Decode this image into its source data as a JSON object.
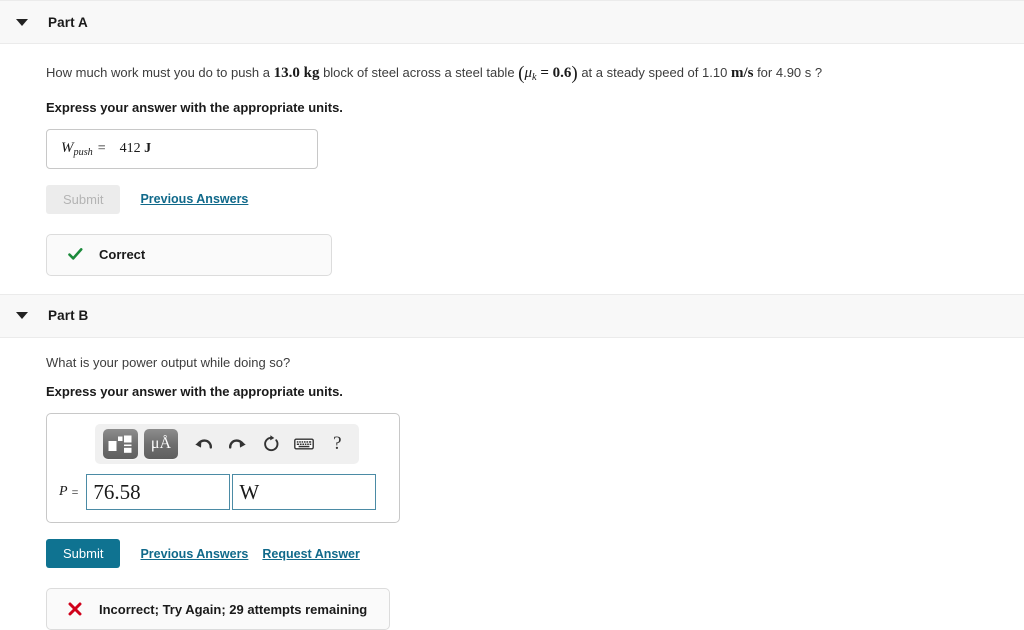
{
  "parts": [
    {
      "id": "a",
      "title": "Part A",
      "caret_icon": "caret-down-icon",
      "question_segments": {
        "pre": "How much work must you do to push a ",
        "mass": "13.0",
        "mass_unit": "kg",
        "mid": " block of steel across a steel table ",
        "mu_symbol": "μ",
        "mu_sub": "k",
        "mu_eq": "=",
        "mu_value": "0.6",
        "mid2": " at a steady speed of ",
        "speed": "1.10",
        "speed_unit": "m/s",
        "mid3": " for ",
        "time": "4.90",
        "time_unit": "s",
        "end": "?"
      },
      "instruction": "Express your answer with the appropriate units.",
      "answer": {
        "symbol": "W",
        "symbol_sub": "push",
        "equals": "=",
        "value": "412",
        "unit": "J"
      },
      "submit_label": "Submit",
      "submit_disabled": true,
      "links": [
        "Previous Answers"
      ],
      "feedback": {
        "status": "correct",
        "icon": "check-icon",
        "text": "Correct",
        "color": "#1b8a3b"
      }
    },
    {
      "id": "b",
      "title": "Part B",
      "caret_icon": "caret-down-icon",
      "question": "What is your power output while doing so?",
      "instruction": "Express your answer with the appropriate units.",
      "editor": {
        "toolbar": [
          {
            "name": "math-template-button",
            "icon": "math-template-icon",
            "type": "button"
          },
          {
            "name": "units-button",
            "icon": "mu-angstrom-icon",
            "label": "μÅ",
            "type": "button"
          },
          {
            "name": "undo-button",
            "icon": "undo-icon",
            "type": "icon"
          },
          {
            "name": "redo-button",
            "icon": "redo-icon",
            "type": "icon"
          },
          {
            "name": "reset-button",
            "icon": "reset-icon",
            "type": "icon"
          },
          {
            "name": "keyboard-button",
            "icon": "keyboard-icon",
            "type": "icon"
          },
          {
            "name": "help-button",
            "icon": "question-mark-icon",
            "label": "?",
            "type": "icon"
          }
        ],
        "label": "P",
        "equals": "=",
        "value": "76.58",
        "value_placeholder": "",
        "unit": "W",
        "unit_placeholder": ""
      },
      "submit_label": "Submit",
      "submit_disabled": false,
      "links": [
        "Previous Answers",
        "Request Answer"
      ],
      "feedback": {
        "status": "incorrect",
        "icon": "x-icon",
        "text": "Incorrect; Try Again; 29 attempts remaining",
        "color": "#d0021b"
      }
    }
  ],
  "colors": {
    "accent": "#0f7391",
    "link": "#10698a",
    "correct": "#1b8a3b",
    "incorrect": "#d0021b",
    "header_bg": "#f8f8f8"
  }
}
